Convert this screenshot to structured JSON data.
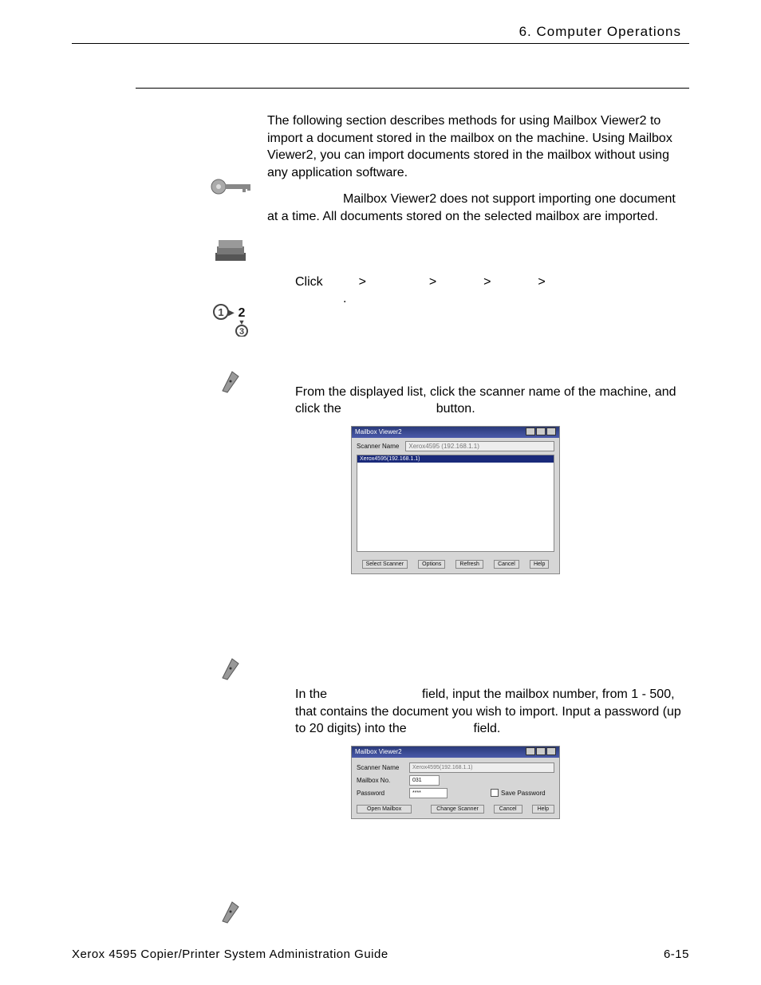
{
  "header": {
    "chapter": "6. Computer Operations"
  },
  "intro": {
    "p1": "The following section describes methods for using Mailbox Viewer2 to import a document stored in the mailbox on the machine.  Using Mailbox Viewer2, you can import documents stored in the mailbox without using any application software.",
    "p2": "Mailbox Viewer2 does not support importing one document at a time. All documents stored on the selected mailbox are imported."
  },
  "step1": {
    "line_a_prefix": "Click ",
    "gt": ">",
    "line_b": "."
  },
  "step2": {
    "para_prefix": "From the displayed list, click the scanner name of the machine, and click the ",
    "para_suffix": " button."
  },
  "shot1": {
    "title": "Mailbox Viewer2",
    "label_scanner_name": "Scanner Name",
    "field_value": "Xerox4595 (192.168.1.1)",
    "list_selected": "Xerox4595(192.168.1.1)",
    "buttons": {
      "select_scanner": "Select Scanner",
      "options": "Options",
      "refresh": "Refresh",
      "cancel": "Cancel",
      "help": "Help"
    }
  },
  "step3": {
    "prefix": "In the ",
    "mid": " field, input the mailbox number, from 1 - 500, that contains the document you wish to import. Input a password (up to 20 digits) into the ",
    "suffix": " field."
  },
  "shot2": {
    "title": "Mailbox Viewer2",
    "labels": {
      "scanner_name": "Scanner Name",
      "mailbox_no": "Mailbox No.",
      "password": "Password",
      "save_password": "Save Password"
    },
    "values": {
      "scanner_name": "Xerox4595(192.168.1.1)",
      "mailbox_no": "031",
      "password": "****"
    },
    "buttons": {
      "open_mailbox": "Open Mailbox",
      "change_scanner": "Change Scanner",
      "cancel": "Cancel",
      "help": "Help"
    }
  },
  "footer": {
    "left": "Xerox 4595 Copier/Printer System Administration Guide",
    "right": "6-15"
  }
}
